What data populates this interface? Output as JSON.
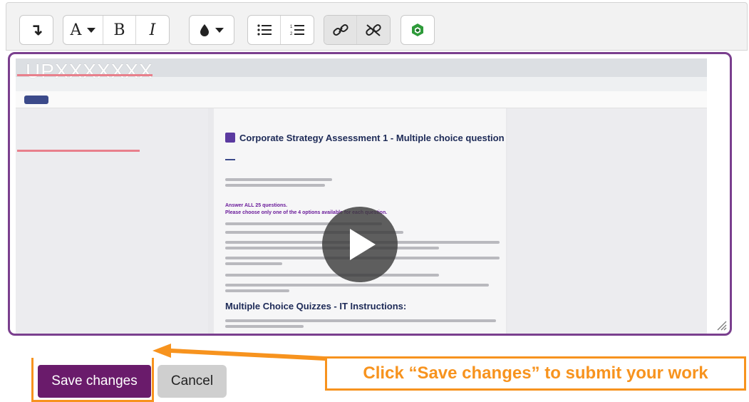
{
  "toolbar": {
    "buttons": [
      {
        "name": "collapse-icon",
        "glyph": "↴"
      },
      {
        "name": "font-size-icon",
        "glyph": "A"
      },
      {
        "name": "bold-icon",
        "glyph": "B"
      },
      {
        "name": "italic-icon",
        "glyph": "I"
      },
      {
        "name": "text-color-icon",
        "glyph": "●"
      },
      {
        "name": "unordered-list-icon",
        "glyph": "☰"
      },
      {
        "name": "ordered-list-icon",
        "glyph": "≡"
      },
      {
        "name": "link-icon",
        "glyph": "⛓"
      },
      {
        "name": "unlink-icon",
        "glyph": "⛓"
      },
      {
        "name": "media-icon",
        "glyph": "◆"
      }
    ]
  },
  "video": {
    "watermark": "UPXXXXXXX",
    "page_title": "Corporate Strategy Assessment 1 - Multiple choice question",
    "section_heading": "Multiple Choice Quizzes - IT Instructions:",
    "instructions_line1": "Answer ALL 25 questions.",
    "instructions_line2": "Please choose only one of the 4 options available for each question."
  },
  "actions": {
    "save_label": "Save changes",
    "cancel_label": "Cancel"
  },
  "annotation": {
    "callout_text": "Click “Save changes” to submit your work",
    "accent_color": "#f7931e"
  },
  "colors": {
    "editor_border": "#7a3f8e",
    "save_button": "#6a1b6b",
    "cancel_button": "#cfcfcf"
  }
}
